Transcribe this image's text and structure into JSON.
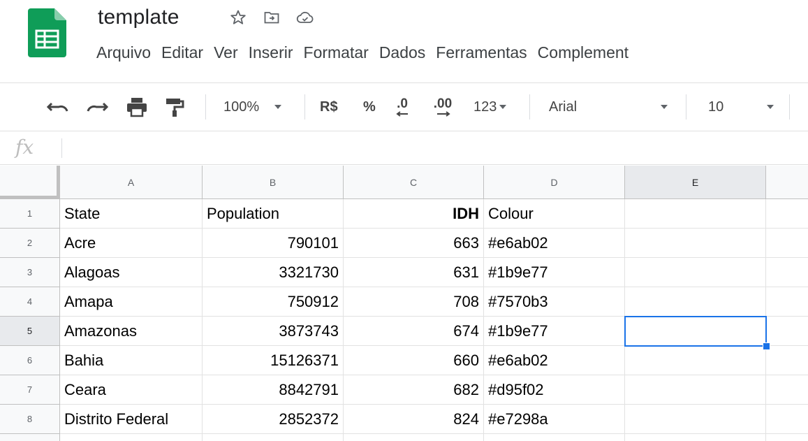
{
  "document": {
    "title": "template"
  },
  "menu": [
    "Arquivo",
    "Editar",
    "Ver",
    "Inserir",
    "Formatar",
    "Dados",
    "Ferramentas",
    "Complement"
  ],
  "toolbar": {
    "zoom": "100%",
    "currency": "R$",
    "percent": "%",
    "decrease_decimals": ".0",
    "increase_decimals": ".00",
    "more_formats": "123",
    "font": "Arial",
    "font_size": "10"
  },
  "formula_bar": {
    "label": "fx",
    "value": ""
  },
  "columns": [
    "A",
    "B",
    "C",
    "D",
    "E"
  ],
  "rows": [
    {
      "num": "1",
      "a": "State",
      "b": "Population",
      "c": "IDH",
      "d": "Colour",
      "e": ""
    },
    {
      "num": "2",
      "a": "Acre",
      "b": "790101",
      "c": "663",
      "d": "#e6ab02",
      "e": ""
    },
    {
      "num": "3",
      "a": "Alagoas",
      "b": "3321730",
      "c": "631",
      "d": "#1b9e77",
      "e": ""
    },
    {
      "num": "4",
      "a": "Amapa",
      "b": "750912",
      "c": "708",
      "d": "#7570b3",
      "e": ""
    },
    {
      "num": "5",
      "a": "Amazonas",
      "b": "3873743",
      "c": "674",
      "d": "#1b9e77",
      "e": ""
    },
    {
      "num": "6",
      "a": "Bahia",
      "b": "15126371",
      "c": "660",
      "d": "#e6ab02",
      "e": ""
    },
    {
      "num": "7",
      "a": "Ceara",
      "b": "8842791",
      "c": "682",
      "d": "#d95f02",
      "e": ""
    },
    {
      "num": "8",
      "a": "Distrito Federal",
      "b": "2852372",
      "c": "824",
      "d": "#e7298a",
      "e": ""
    }
  ],
  "selection": {
    "column": "E",
    "row": "5"
  },
  "colors": {
    "sheets_green": "#0f9d58",
    "selection_blue": "#1a73e8",
    "header_bg": "#f8f9fa"
  }
}
